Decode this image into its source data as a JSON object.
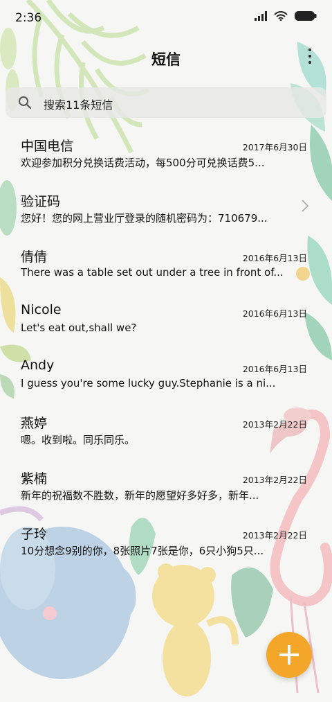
{
  "status_bar": {
    "time": "2:36",
    "icons": [
      "signal-icon",
      "wifi-icon",
      "battery-icon"
    ]
  },
  "header": {
    "title": "短信",
    "menu_icon": "more-vertical-icon"
  },
  "search": {
    "placeholder": "搜索11条短信",
    "icon": "search-icon"
  },
  "conversations": [
    {
      "name": "中国电信",
      "date": "2017年6月30日",
      "snippet": "欢迎参加积分兑换话费活动，每500分可兑换话费5..."
    },
    {
      "name": "验证码",
      "date": "",
      "snippet": "您好！您的网上营业厅登录的随机密码为：710679..."
    },
    {
      "name": "倩倩",
      "date": "2016年6月13日",
      "snippet": "There was a table set out under a tree in front of..."
    },
    {
      "name": "Nicole",
      "date": "2016年6月13日",
      "snippet": "Let's eat out,shall we?"
    },
    {
      "name": "Andy",
      "date": "2016年6月13日",
      "snippet": "I guess you're some lucky guy.Stephanie is a ni..."
    },
    {
      "name": "燕婷",
      "date": "2013年2月22日",
      "snippet": "嗯。收到啦。同乐同乐。"
    },
    {
      "name": "紫楠",
      "date": "2013年2月22日",
      "snippet": "新年的祝福数不胜数，新年的愿望好多好多，新年..."
    },
    {
      "name": "子玲",
      "date": "2013年2月22日",
      "snippet": "10分想念9别的你，8张照片7张是你，6只小狗5只..."
    }
  ],
  "fab": {
    "icon": "plus-icon",
    "color": "#f4a62a"
  },
  "colors": {
    "accent": "#f4a62a",
    "background": "#f6f7f5"
  }
}
